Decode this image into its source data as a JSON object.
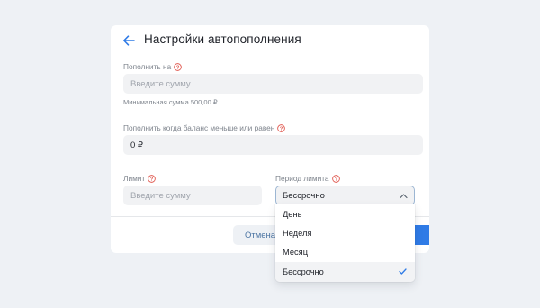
{
  "header": {
    "title": "Настройки автопополнения",
    "back_icon": "arrow-left-icon"
  },
  "amount": {
    "label": "Пополнить на",
    "placeholder": "Введите сумму",
    "hint": "Минимальная сумма 500,00 ₽"
  },
  "threshold": {
    "label": "Пополнить когда баланс меньше или равен",
    "value": "0 ₽"
  },
  "limit": {
    "label": "Лимит",
    "placeholder": "Введите сумму"
  },
  "period": {
    "label": "Период лимита",
    "selected": "Бессрочно",
    "options": [
      "День",
      "Неделя",
      "Месяц",
      "Бессрочно"
    ]
  },
  "footer": {
    "cancel_label": "Отмена"
  },
  "colors": {
    "accent": "#2f7be6",
    "help_icon": "#e0584f",
    "link": "#4c75a3",
    "background": "#eef1f5"
  }
}
